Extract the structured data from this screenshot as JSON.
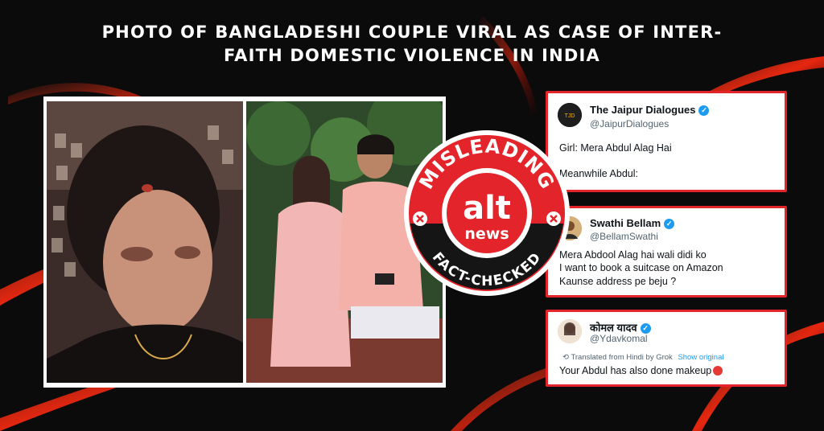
{
  "headline": {
    "line1": "PHOTO OF BANGLADESHI COUPLE VIRAL AS CASE OF INTER-",
    "line2": "FAITH DOMESTIC VIOLENCE IN INDIA"
  },
  "badge": {
    "top_text": "MISLEADING",
    "bottom_text": "FACT-CHECKED",
    "logo_line1": "alt",
    "logo_line2": "news",
    "color": "#e3242b"
  },
  "tweets": [
    {
      "name": "The Jaipur Dialogues",
      "handle": "@JaipurDialogues",
      "lines": [
        "Girl: Mera Abdul Alag Hai",
        "Meanwhile Abdul:"
      ]
    },
    {
      "name": "Swathi Bellam",
      "handle": "@BellamSwathi",
      "lines": [
        "Mera Abdool Alag hai wali didi ko",
        "I want to book a suitcase on Amazon",
        "Kaunse address pe beju ?"
      ]
    },
    {
      "name": "कोमल यादव",
      "handle": "@Ydavkomal",
      "translated_note": "Translated from Hindi by Grok",
      "show_original": "Show original",
      "lines": [
        "Your Abdul has also done makeup"
      ]
    }
  ],
  "colors": {
    "accent": "#e3242b",
    "verified": "#1d9bf0",
    "background": "#0b0b0b"
  }
}
